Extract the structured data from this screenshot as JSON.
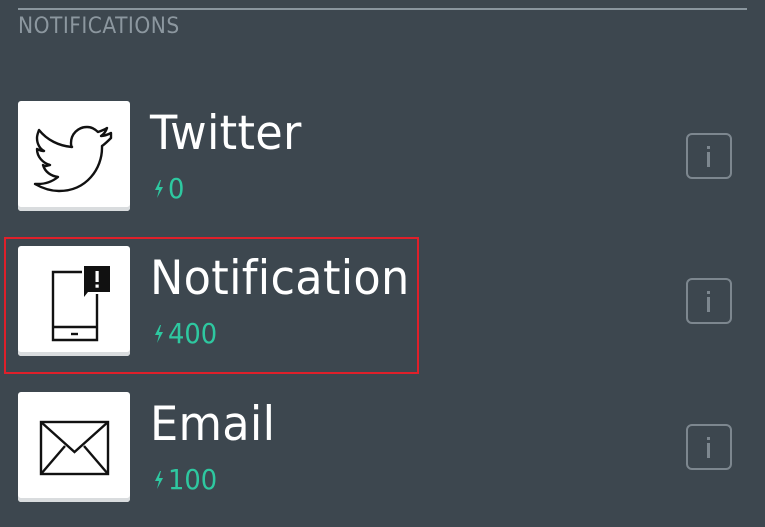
{
  "section": {
    "title": "NOTIFICATIONS"
  },
  "widgets": [
    {
      "name": "Twitter",
      "cost": "0",
      "icon": "twitter-bird-icon"
    },
    {
      "name": "Notification",
      "cost": "400",
      "icon": "phone-notification-icon"
    },
    {
      "name": "Email",
      "cost": "100",
      "icon": "envelope-icon"
    }
  ],
  "colors": {
    "background": "#3d474f",
    "energy": "#2ec8a0",
    "highlight": "#e0202a",
    "tile": "#ffffff"
  },
  "highlighted_widget": "Notification"
}
